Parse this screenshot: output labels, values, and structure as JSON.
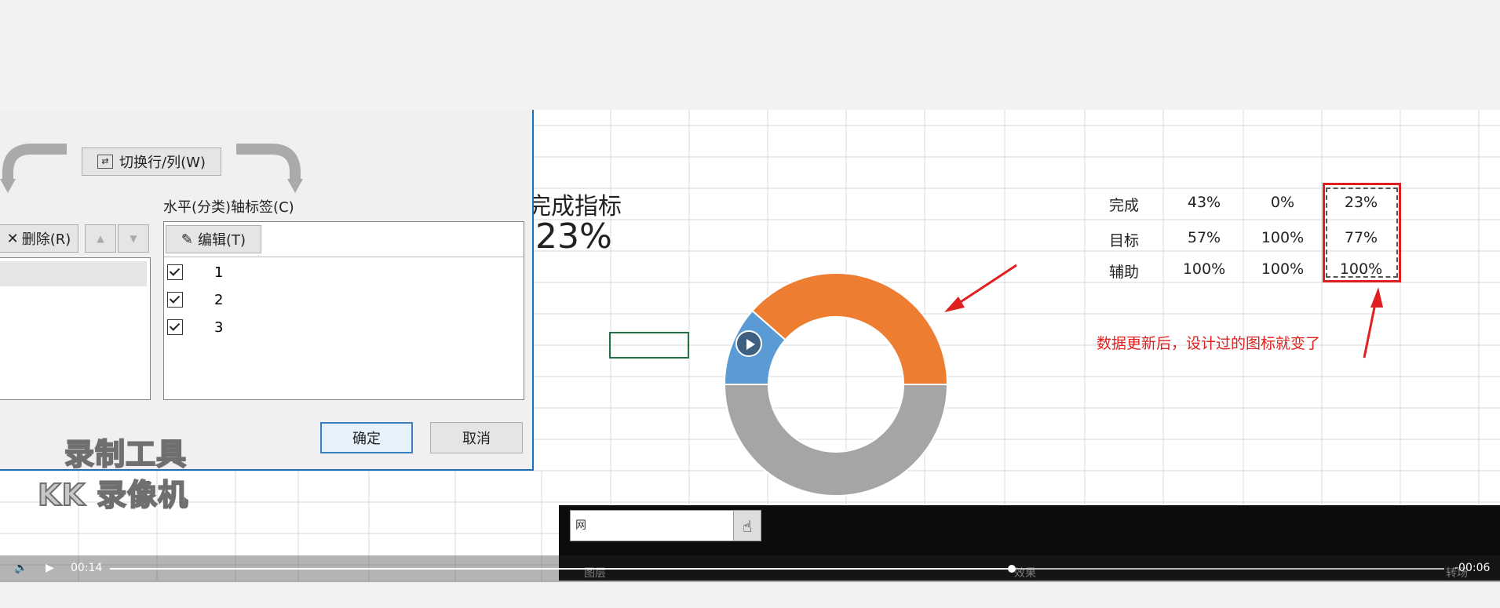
{
  "dialog": {
    "switch_row_col": "切换行/列(W)",
    "axis_label_title": "水平(分类)轴标签(C)",
    "delete_label": "删除(R)",
    "edit_label": "编辑(T)",
    "axis_items": [
      "1",
      "2",
      "3"
    ],
    "ok_label": "确定",
    "cancel_label": "取消"
  },
  "sheet": {
    "kpi_title": "完成指标",
    "kpi_value": "23%",
    "table": {
      "rows": [
        {
          "label": "完成",
          "values": [
            "43%",
            "0%",
            "23%"
          ]
        },
        {
          "label": "目标",
          "values": [
            "57%",
            "100%",
            "77%"
          ]
        },
        {
          "label": "辅助",
          "values": [
            "100%",
            "100%",
            "100%"
          ]
        }
      ]
    },
    "annotation": "数据更新后，设计过的图标就变了",
    "annotation_color": "#e02020",
    "chart_colors": {
      "orange": "#ed7d31",
      "blue": "#5b9bd5",
      "gray": "#a5a5a5"
    }
  },
  "chart_data": {
    "type": "pie",
    "variant": "doughnut",
    "series": [
      {
        "values": [
          23,
          77,
          100
        ]
      }
    ]
  },
  "search_box": {
    "value": "网"
  },
  "watermark": {
    "line1": "录制工具",
    "line2": "KK 录像机"
  },
  "player": {
    "current_time": "00:14",
    "remaining_time": "-00:06",
    "progress": 0.676,
    "bottom_labels": [
      "图层",
      "效果",
      "转场"
    ]
  }
}
